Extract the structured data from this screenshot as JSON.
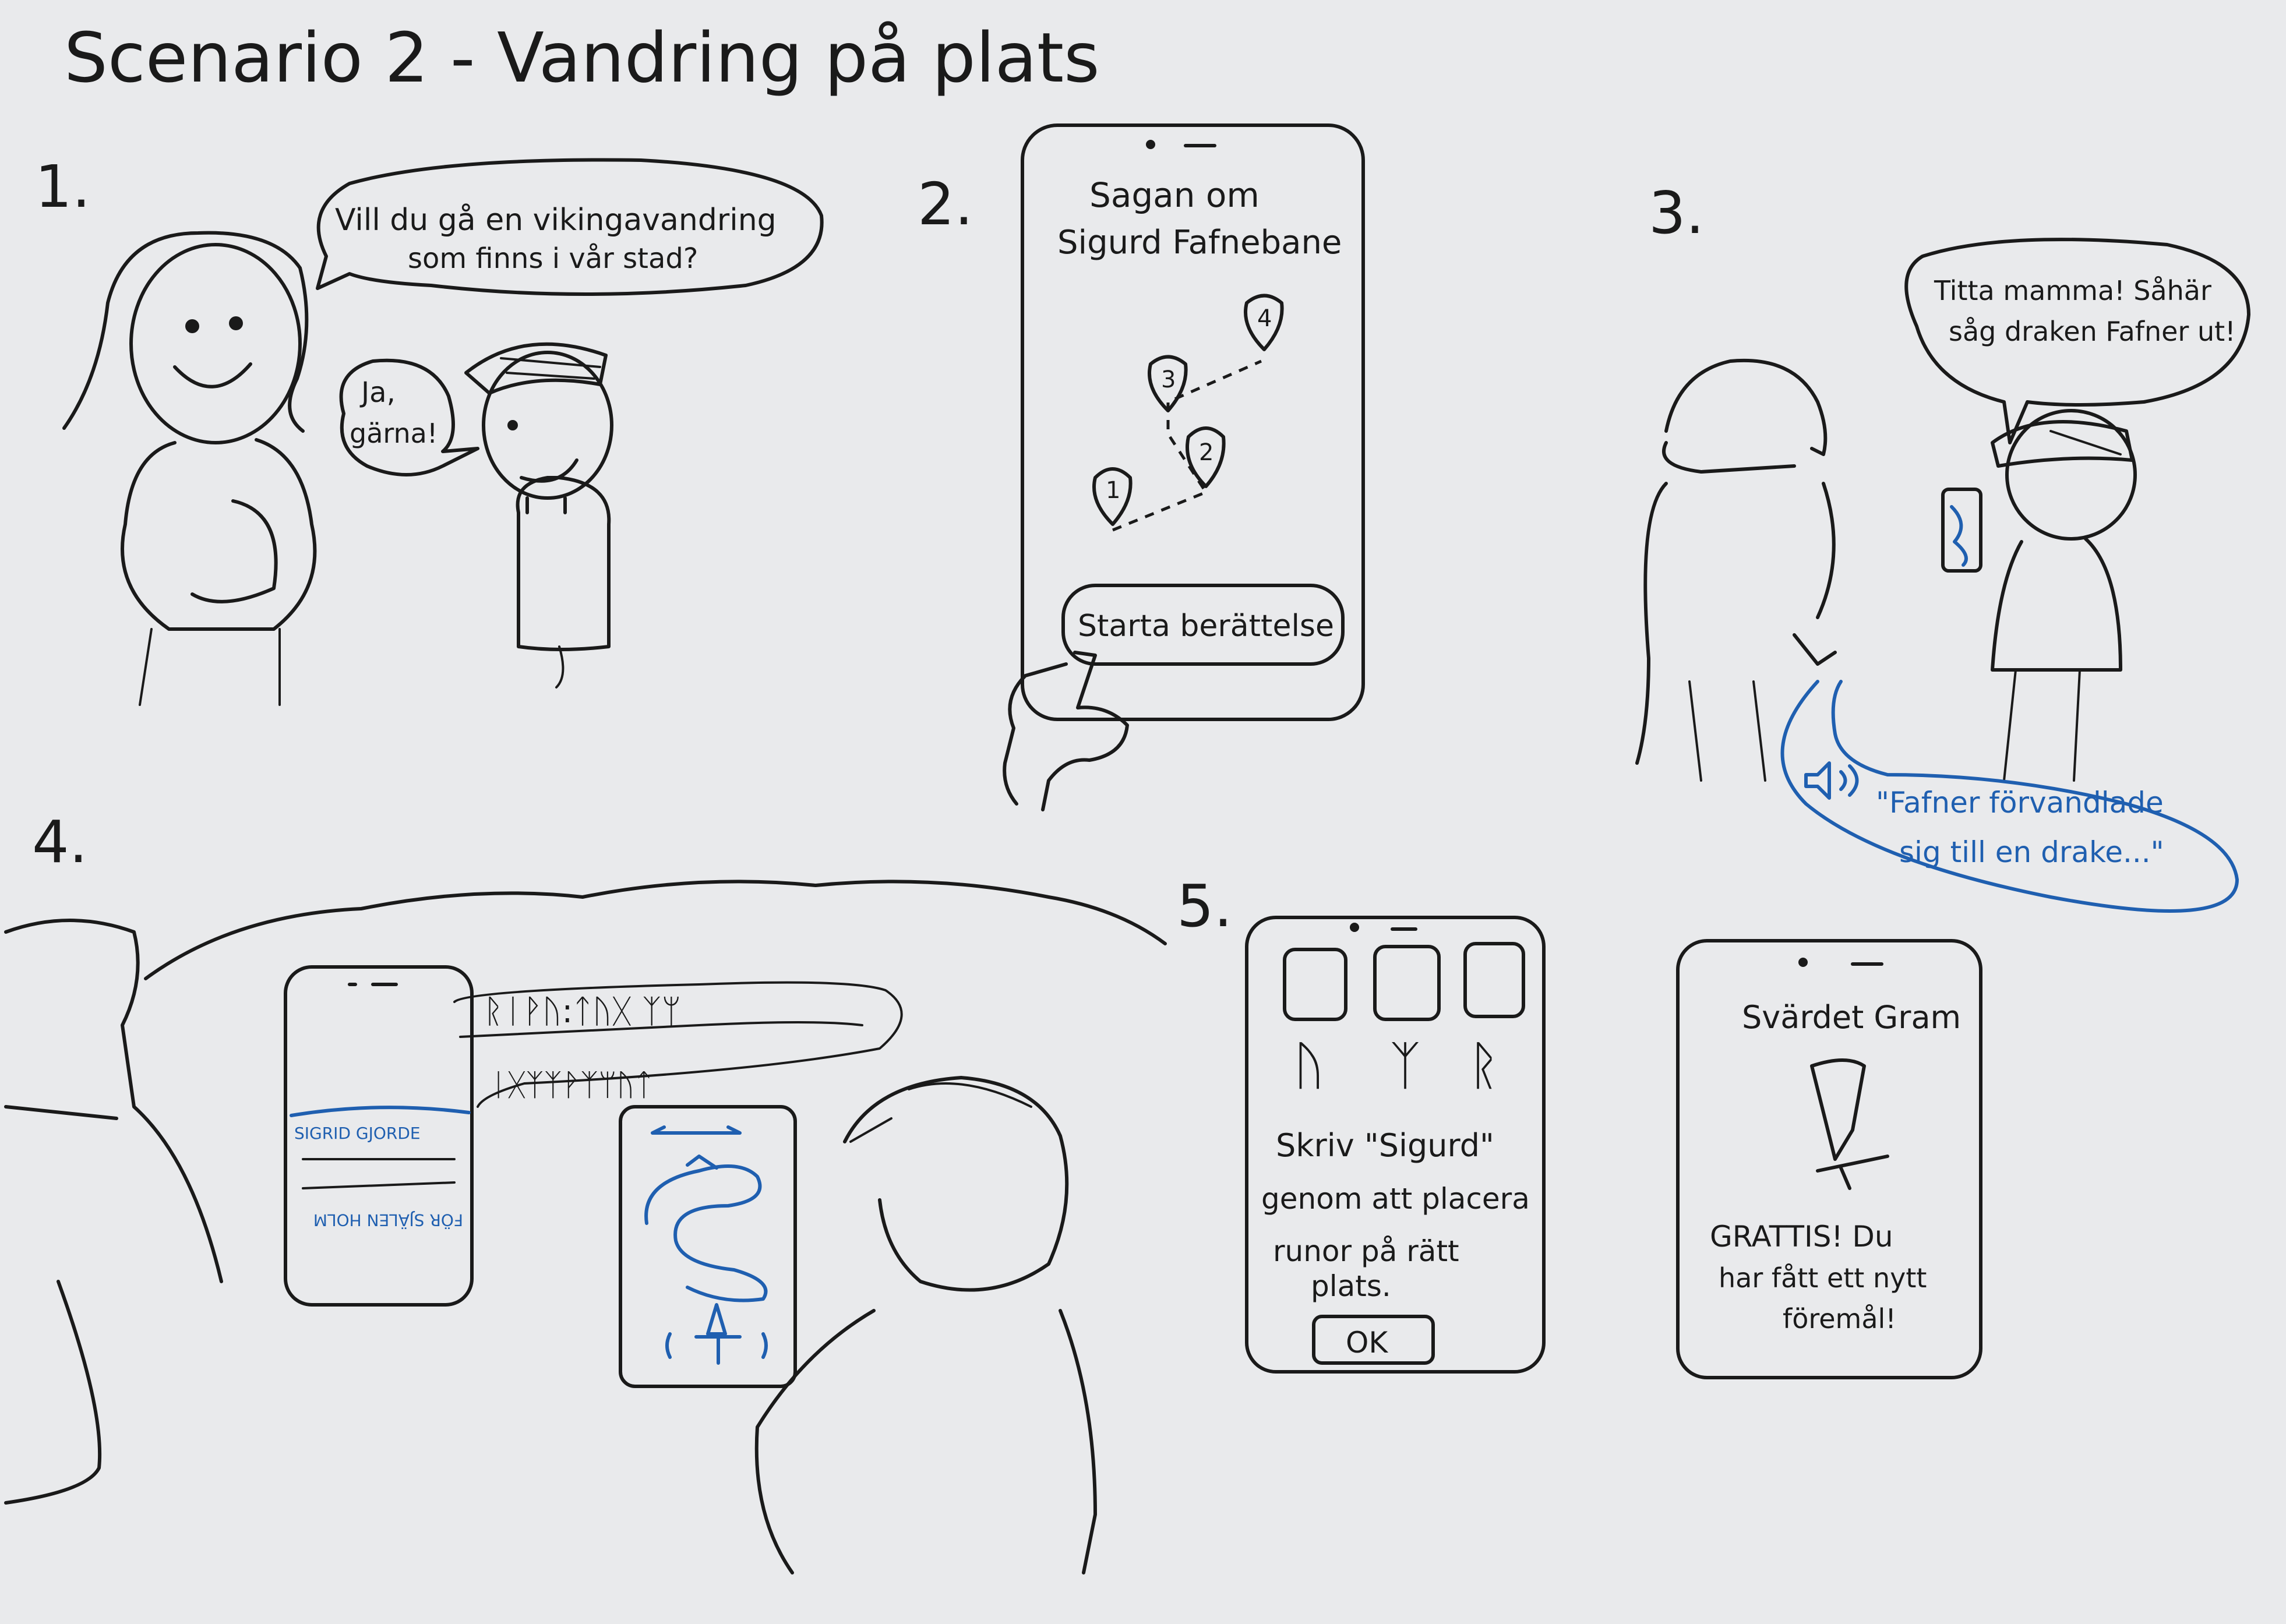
{
  "title": "Scenario 2 - Vandring på plats",
  "panels": {
    "p1": {
      "number": "1.",
      "bubble_line1": "Vill du gå en vikingavandring",
      "bubble_line2": "som finns i vår stad?",
      "reply_line1": "Ja,",
      "reply_line2": "gärna!"
    },
    "p2": {
      "number": "2.",
      "title_line1": "Sagan om",
      "title_line2": "Sigurd Fafnebane",
      "markers": [
        "1",
        "2",
        "3",
        "4"
      ],
      "button_label": "Starta berättelse"
    },
    "p3": {
      "number": "3.",
      "bubble_line1": "Titta mamma! Såhär",
      "bubble_line2": "såg draken Fafner ut!",
      "audio_line1": "\"Fafner förvandlade",
      "audio_line2": "sig till en drake...\""
    },
    "p4": {
      "number": "4.",
      "runes_top": "ᚱᛁᚹᚢ:ᛏᚢᚷ ᛉᛘ",
      "runes_bottom": "ᛁᚷᛉᛉᚹᛉᛘᚢᛏ",
      "phone_text_1": "SIGRID GJORDE",
      "phone_text_2": "FÖR SJÄLEN HOLM"
    },
    "p5": {
      "number": "5.",
      "runes": [
        "ᚢ",
        "ᛉ",
        "ᚱ"
      ],
      "instr_line1": "Skriv \"Sigurd\"",
      "instr_line2": "genom att placera",
      "instr_line3": "runor på rätt",
      "instr_line4": "plats.",
      "ok_label": "OK",
      "reward_title": "Svärdet Gram",
      "reward_line1": "GRATTIS! Du",
      "reward_line2": "har fått ett nytt",
      "reward_line3": "föremål!"
    }
  },
  "colors": {
    "paper": "#e9eaec",
    "ink": "#1a1a1a",
    "blue_ink": "#1f5fb0"
  },
  "icons": [
    "speaker-icon",
    "sword-icon",
    "map-pin-icon",
    "finger-tap-icon",
    "dragon-icon"
  ]
}
